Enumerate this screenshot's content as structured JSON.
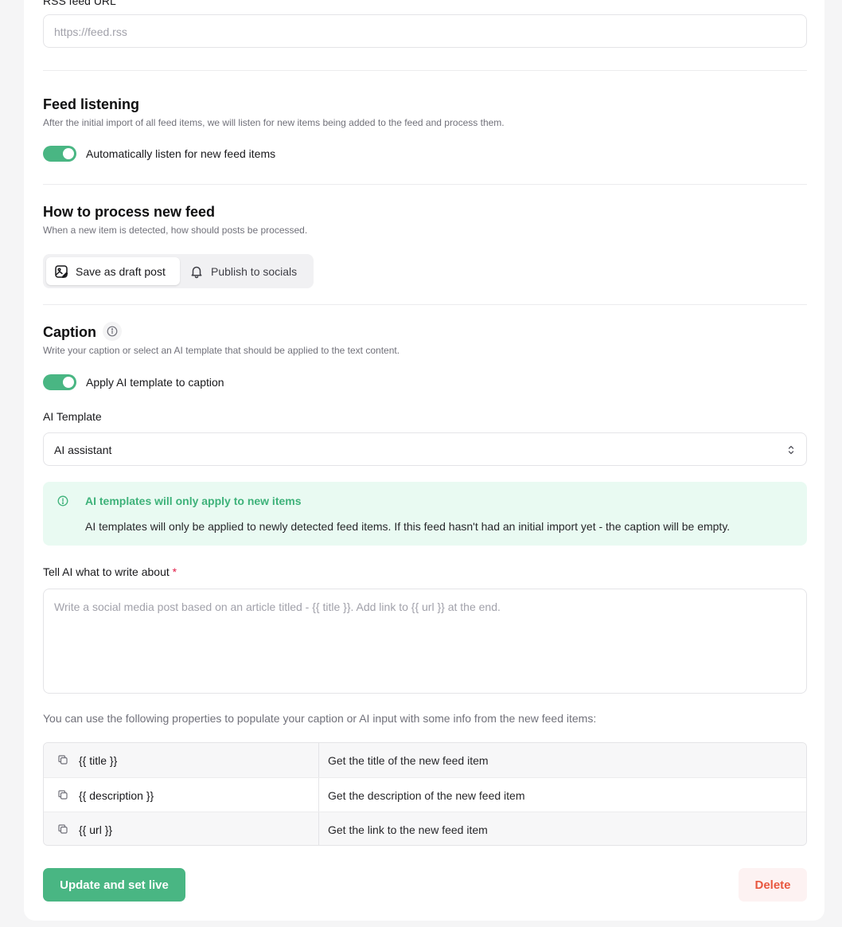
{
  "rss": {
    "label": "RSS feed URL",
    "placeholder": "https://feed.rss"
  },
  "feed_listening": {
    "title": "Feed listening",
    "description": "After the initial import of all feed items, we will listen for new items being added to the feed and process them.",
    "toggle_label": "Automatically listen for new feed items",
    "toggle_on": true
  },
  "process": {
    "title": "How to process new feed",
    "description": "When a new item is detected, how should posts be processed.",
    "options": [
      {
        "label": "Save as draft post",
        "icon": "draft-image-icon",
        "selected": true
      },
      {
        "label": "Publish to socials",
        "icon": "bell-icon",
        "selected": false
      }
    ]
  },
  "caption": {
    "title": "Caption",
    "description": "Write your caption or select an AI template that should be applied to the text content.",
    "toggle_label": "Apply AI template to caption",
    "toggle_on": true
  },
  "ai_template": {
    "label": "AI Template",
    "value": "AI assistant"
  },
  "alert": {
    "title": "AI templates will only apply to new items",
    "body": "AI templates will only be applied to newly detected feed items. If this feed hasn't had an initial import yet - the caption will be empty."
  },
  "prompt": {
    "label": "Tell AI what to write about",
    "required_mark": "*",
    "placeholder": "Write a social media post based on an article titled - {{ title }}. Add link to {{ url }} at the end."
  },
  "properties": {
    "help": "You can use the following properties to populate your caption or AI input with some info from the new feed items:",
    "rows": [
      {
        "key": "{{ title }}",
        "value": "Get the title of the new feed item"
      },
      {
        "key": "{{ description }}",
        "value": "Get the description of the new feed item"
      },
      {
        "key": "{{ url }}",
        "value": "Get the link to the new feed item"
      }
    ]
  },
  "actions": {
    "primary": "Update and set live",
    "danger": "Delete"
  },
  "colors": {
    "accent": "#49b683",
    "danger": "#e8573f",
    "alert_bg": "#e9faf2"
  }
}
